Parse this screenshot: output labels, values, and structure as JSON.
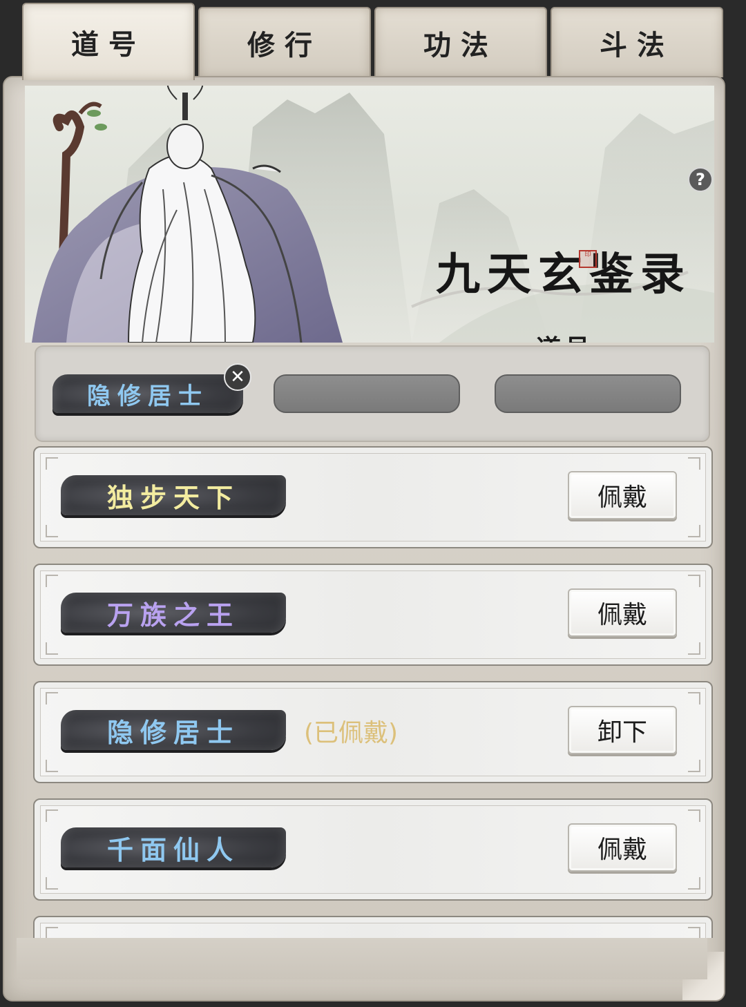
{
  "tabs": [
    {
      "label": "道号",
      "active": true
    },
    {
      "label": "修行",
      "active": false
    },
    {
      "label": "功法",
      "active": false
    },
    {
      "label": "斗法",
      "active": false
    }
  ],
  "banner": {
    "title": "九天玄鉴录",
    "subtitle": "道号",
    "seal_text": "印",
    "help_icon": "question-icon"
  },
  "equipped_slots": [
    {
      "title": "隐修居士",
      "color": "#8fc8f0",
      "filled": true
    },
    {
      "title": "",
      "filled": false
    },
    {
      "title": "",
      "filled": false
    }
  ],
  "remove_icon_glyph": "✕",
  "titles": [
    {
      "name": "独步天下",
      "color": "#f3eca0",
      "status": "",
      "action": "佩戴"
    },
    {
      "name": "万族之王",
      "color": "#b9a2f0",
      "status": "",
      "action": "佩戴"
    },
    {
      "name": "隐修居士",
      "color": "#8fc8f0",
      "status": "(已佩戴)",
      "action": "卸下"
    },
    {
      "name": "千面仙人",
      "color": "#8fc8f0",
      "status": "",
      "action": "佩戴"
    }
  ]
}
